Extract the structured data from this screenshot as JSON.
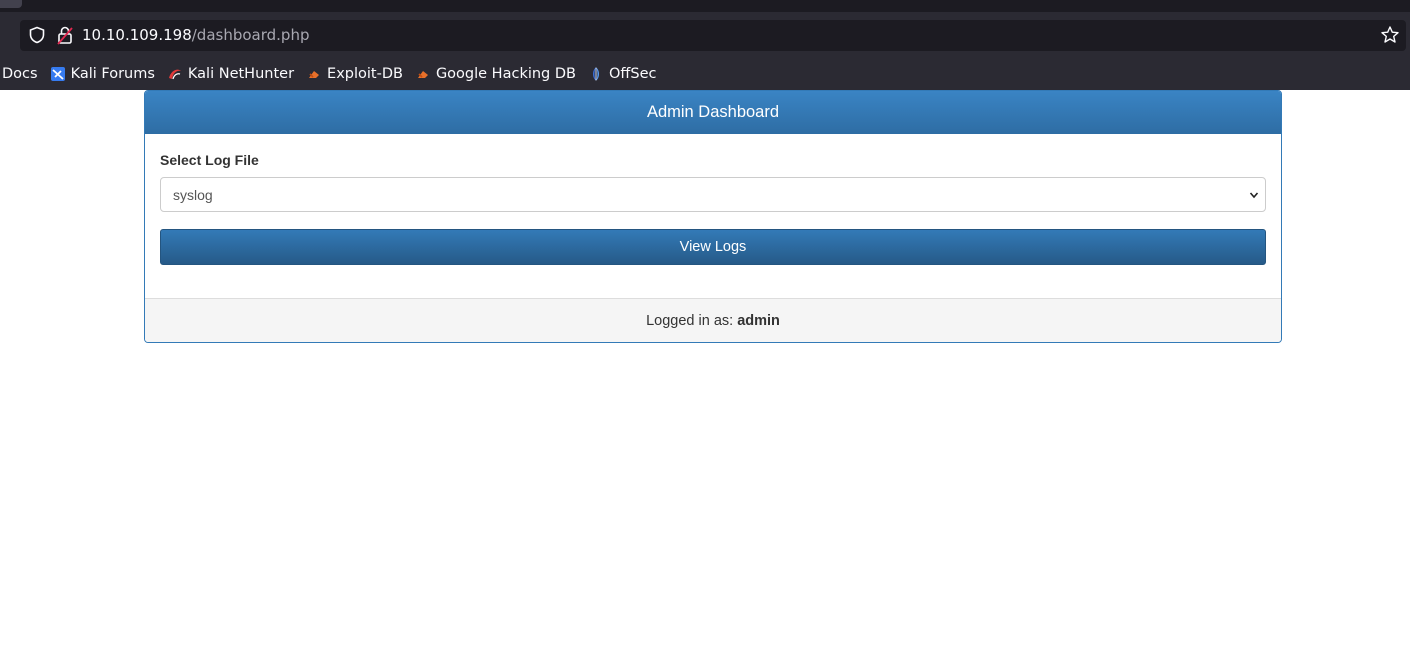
{
  "browser": {
    "url_host": "10.10.109.198",
    "url_path": "/dashboard.php"
  },
  "bookmarks": [
    {
      "label": "Docs",
      "icon": "none"
    },
    {
      "label": "Kali Forums",
      "icon": "kali-forums-icon"
    },
    {
      "label": "Kali NetHunter",
      "icon": "kali-nethunter-icon"
    },
    {
      "label": "Exploit-DB",
      "icon": "exploit-db-icon"
    },
    {
      "label": "Google Hacking DB",
      "icon": "ghdb-icon"
    },
    {
      "label": "OffSec",
      "icon": "offsec-icon"
    }
  ],
  "panel": {
    "title": "Admin Dashboard",
    "field_label": "Select Log File",
    "selected_log": "syslog",
    "button_label": "View Logs",
    "footer_prefix": "Logged in as:",
    "username": "admin"
  },
  "colors": {
    "primary": "#337ab7",
    "chrome_dark": "#1c1b22",
    "chrome": "#2b2a33"
  }
}
